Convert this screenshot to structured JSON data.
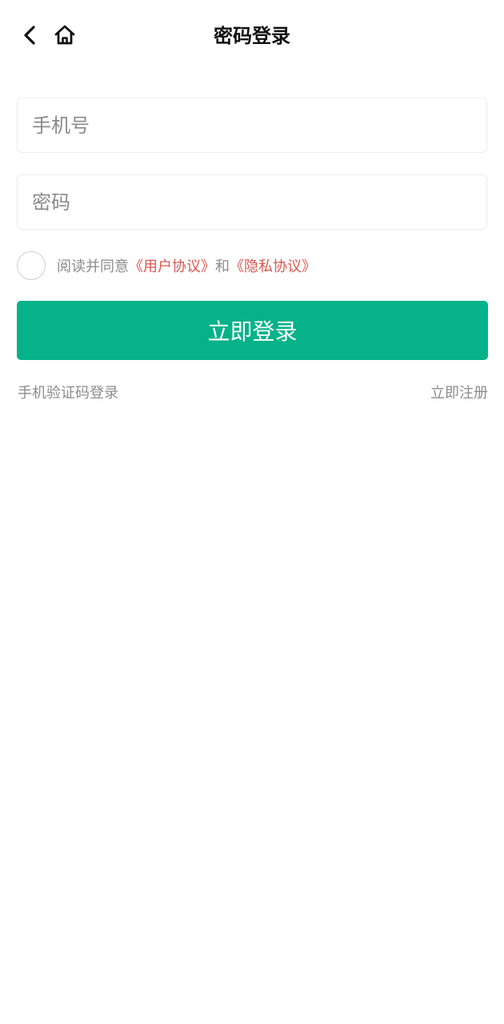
{
  "header": {
    "title": "密码登录",
    "back_icon": "chevron-left-icon",
    "home_icon": "home-icon"
  },
  "form": {
    "phone_placeholder": "手机号",
    "phone_value": "",
    "password_placeholder": "密码",
    "password_value": ""
  },
  "agreement": {
    "checked": false,
    "prefix": "阅读并同意",
    "user_agreement": "《用户协议》",
    "conjunction": "和",
    "privacy_agreement": "《隐私协议》",
    "link_color": "#d9574f"
  },
  "login_button": {
    "label": "立即登录",
    "color": "#05b28a"
  },
  "links": {
    "sms_login": "手机验证码登录",
    "register": "立即注册"
  }
}
